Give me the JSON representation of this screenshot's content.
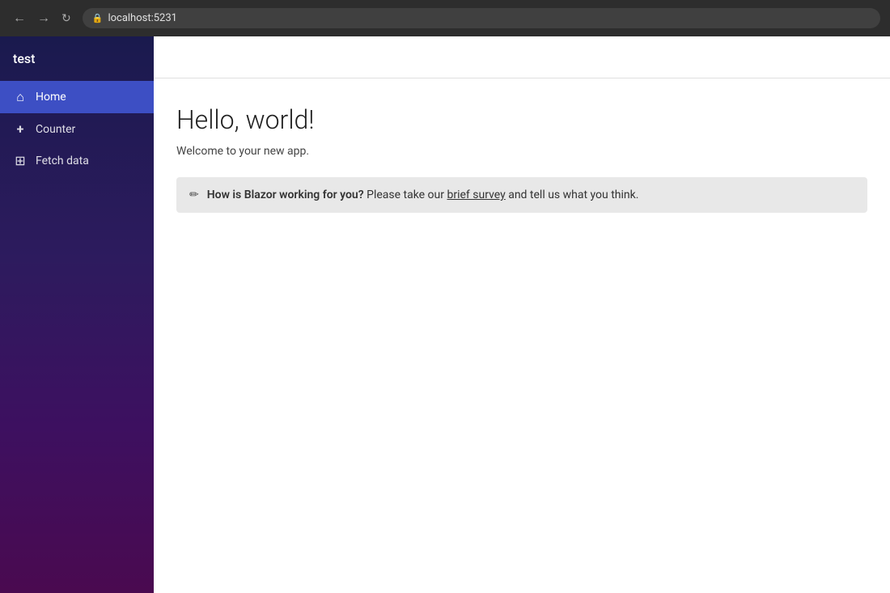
{
  "browser": {
    "url": "localhost:5231"
  },
  "app": {
    "title": "test"
  },
  "sidebar": {
    "items": [
      {
        "id": "home",
        "label": "Home",
        "icon": "home",
        "active": true
      },
      {
        "id": "counter",
        "label": "Counter",
        "icon": "plus",
        "active": false
      },
      {
        "id": "fetch-data",
        "label": "Fetch data",
        "icon": "grid",
        "active": false
      }
    ]
  },
  "main": {
    "heading": "Hello, world!",
    "subheading": "Welcome to your new app.",
    "survey": {
      "bold_text": "How is Blazor working for you?",
      "pre_link": " Please take our ",
      "link_text": "brief survey",
      "post_link": " and tell us what you think."
    }
  }
}
